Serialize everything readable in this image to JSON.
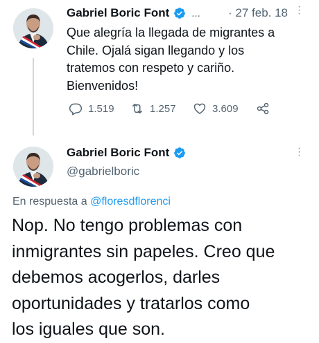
{
  "tweet1": {
    "author_name": "Gabriel Boric Font",
    "truncation": "...",
    "date": "· 27 feb. 18",
    "text_lines": [
      "Que alegría la llegada de migrantes a",
      "Chile. Ojalá sigan llegando y los",
      "tratemos con respeto y cariño.",
      "Bienvenidos!"
    ],
    "replies": "1.519",
    "retweets": "1.257",
    "likes": "3.609"
  },
  "tweet2": {
    "author_name": "Gabriel Boric Font",
    "handle": "@gabrielboric",
    "reply_prefix": "En respuesta a",
    "reply_to": "@floresdflorenci",
    "text_lines": [
      "Nop. No tengo problemas con",
      "inmigrantes sin papeles. Creo que",
      "debemos acogerlos, darles",
      "oportunidades y tratarlos como",
      "los iguales que son."
    ]
  },
  "icons": {
    "verified": "verified-badge-icon",
    "reply": "reply-icon",
    "retweet": "retweet-icon",
    "like": "heart-icon",
    "share": "share-icon",
    "more": "more-icon"
  },
  "colors": {
    "verified": "#1d9bf0",
    "link": "#1d9bf0",
    "muted": "#536471",
    "thread_line": "#cfd9de"
  }
}
